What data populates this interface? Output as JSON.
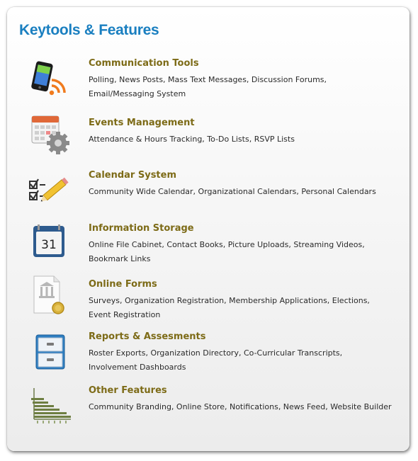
{
  "panel": {
    "title": "Keytools & Features"
  },
  "features": [
    {
      "title": "Communication Tools",
      "description": "Polling, News Posts, Mass Text Messages, Discussion Forums, Email/Messaging System",
      "icon": "phone-rss-icon"
    },
    {
      "title": "Events Management",
      "description": "Attendance & Hours Tracking, To-Do Lists, RSVP Lists",
      "icon": "calendar-gear-icon"
    },
    {
      "title": "Calendar System",
      "description": "Community Wide Calendar, Organizational Calendars, Personal Calendars",
      "icon": "checklist-pencil-icon"
    },
    {
      "title": "Information Storage",
      "description": "Online File Cabinet, Contact Books, Picture Uploads, Streaming Videos, Bookmark Links",
      "icon": "calendar-31-icon",
      "icon_text": "31"
    },
    {
      "title": "Online Forms",
      "description": "Surveys, Organization Registration, Membership Applications, Elections, Event Registration",
      "icon": "certificate-icon"
    },
    {
      "title": "Reports & Assesments",
      "description": "Roster Exports, Organization Directory, Co-Curricular Transcripts, Involvement Dashboards",
      "icon": "file-cabinet-icon"
    },
    {
      "title": "Other Features",
      "description": "Community Branding, Online Store, Notifications, News Feed, Website Builder",
      "icon": "bar-chart-icon"
    }
  ],
  "colors": {
    "title": "#1a7fc0",
    "feature_title": "#7d6b17",
    "description": "#2a2a2a"
  }
}
